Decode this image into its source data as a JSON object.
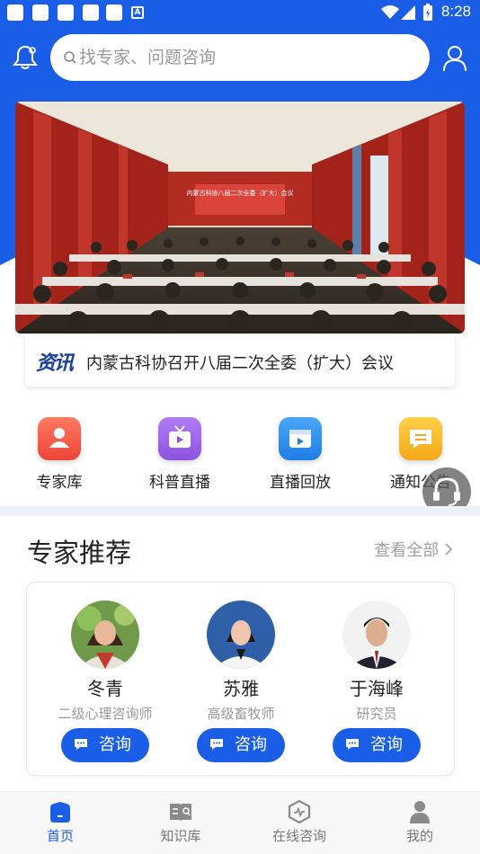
{
  "status_bar": {
    "time": "8:28",
    "badge": "A"
  },
  "header": {
    "search_placeholder": "找专家、问题咨询"
  },
  "news": {
    "tag": "资讯",
    "title": "内蒙古科协召开八届二次全委（扩大）会议"
  },
  "banner": {
    "screen_text": "内蒙古科协八届二次全委（扩大）会议"
  },
  "quick_menu": [
    {
      "label": "专家库",
      "icon": "expert-library-icon",
      "color": "#f0564a"
    },
    {
      "label": "科普直播",
      "icon": "tv-live-icon",
      "color": "#9a63e8"
    },
    {
      "label": "直播回放",
      "icon": "video-replay-icon",
      "color": "#2b8ef0"
    },
    {
      "label": "通知公告",
      "icon": "message-notice-icon",
      "color": "#f7b51d"
    }
  ],
  "experts_section": {
    "title": "专家推荐",
    "view_all": "查看全部",
    "experts": [
      {
        "name": "冬青",
        "title": "二级心理咨询师",
        "button": "咨询"
      },
      {
        "name": "苏雅",
        "title": "高级畜牧师",
        "button": "咨询"
      },
      {
        "name": "于海峰",
        "title": "研究员",
        "button": "咨询"
      }
    ]
  },
  "tabbar": [
    {
      "label": "首页",
      "icon": "home-icon",
      "active": true
    },
    {
      "label": "知识库",
      "icon": "knowledge-icon",
      "active": false
    },
    {
      "label": "在线咨询",
      "icon": "consult-icon",
      "active": false
    },
    {
      "label": "我的",
      "icon": "profile-icon",
      "active": false
    }
  ],
  "colors": {
    "primary": "#1a5ee8",
    "text": "#222222",
    "muted": "#999999"
  }
}
